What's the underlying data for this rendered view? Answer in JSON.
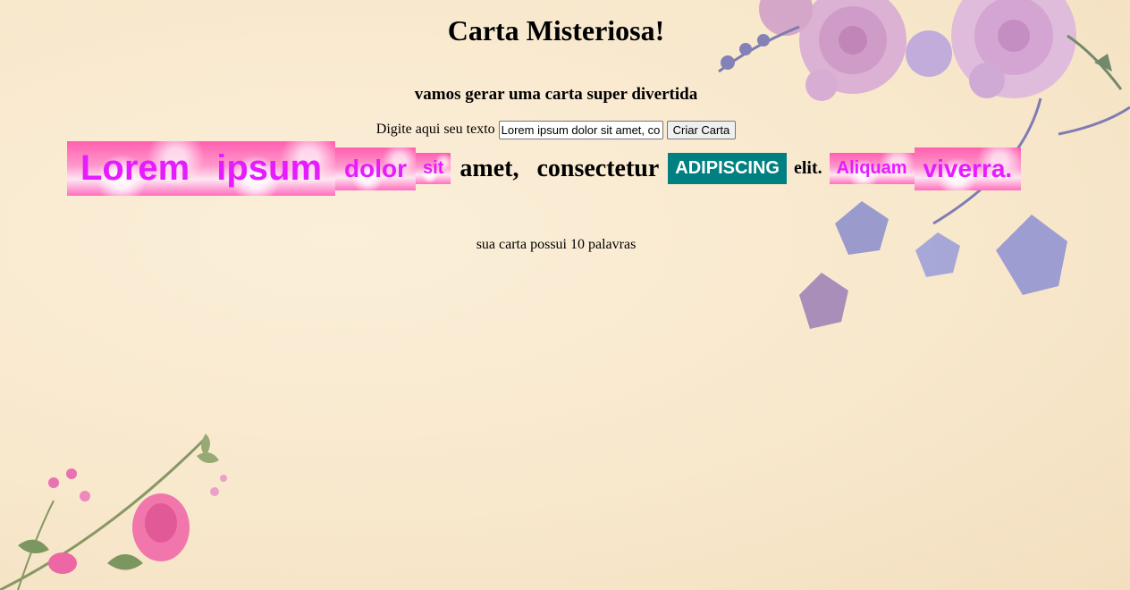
{
  "title": "Carta Misteriosa!",
  "subtitle": "vamos gerar uma carta super divertida",
  "input_label": "Digite aqui seu texto",
  "input_value": "Lorem ipsum dolor sit amet, consectetur adipiscing elit. Aliquam viverra.",
  "button_label": "Criar Carta",
  "words": [
    "Lorem",
    "ipsum",
    "dolor",
    "sit",
    "amet,",
    "consectetur",
    "ADIPISCING",
    "elit.",
    "Aliquam",
    "viverra."
  ],
  "word_count_text": "sua carta possui 10 palavras",
  "colors": {
    "accent_pink": "#e51cff",
    "accent_teal": "#008080"
  }
}
